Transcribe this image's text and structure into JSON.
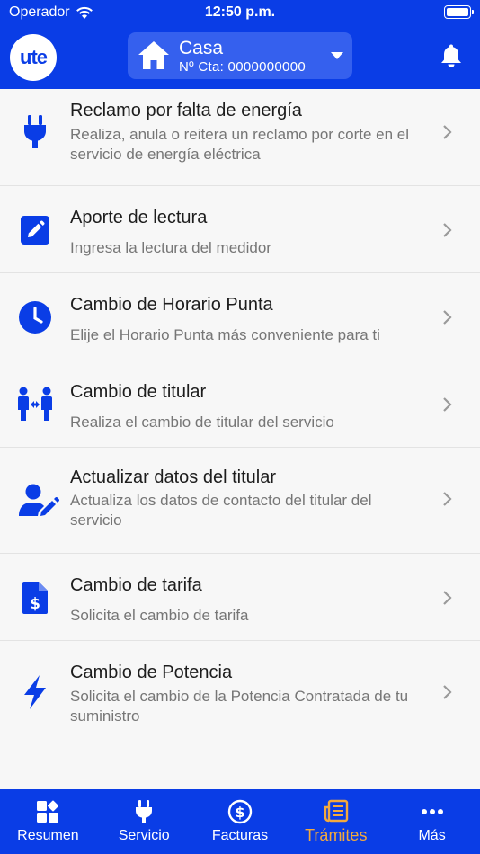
{
  "status_bar": {
    "carrier": "Operador",
    "time": "12:50 p.m."
  },
  "header": {
    "logo_text": "ute",
    "account_name": "Casa",
    "account_number": "Nº Cta: 0000000000"
  },
  "items": [
    {
      "icon": "plug-icon",
      "title": "Reclamo por falta de energía",
      "desc": "Realiza, anula o reitera un reclamo por corte en el servicio de energía eléctrica"
    },
    {
      "icon": "edit-icon",
      "title": "Aporte de lectura",
      "desc": "Ingresa la lectura del medidor"
    },
    {
      "icon": "clock-icon",
      "title": "Cambio de Horario Punta",
      "desc": "Elije el Horario Punta más conveniente para ti"
    },
    {
      "icon": "people-swap-icon",
      "title": "Cambio de titular",
      "desc": "Realiza el cambio de titular del servicio"
    },
    {
      "icon": "user-edit-icon",
      "title": "Actualizar datos del titular",
      "desc": "Actualiza los datos de contacto del titular del servicio"
    },
    {
      "icon": "invoice-dollar-icon",
      "title": "Cambio de tarifa",
      "desc": "Solicita el cambio de tarifa"
    },
    {
      "icon": "lightning-icon",
      "title": "Cambio de Potencia",
      "desc": "Solicita el cambio de la Potencia Contratada de tu suministro"
    }
  ],
  "tabs": [
    {
      "icon": "dashboard-icon",
      "label": "Resumen"
    },
    {
      "icon": "plug-icon",
      "label": "Servicio"
    },
    {
      "icon": "dollar-circle-icon",
      "label": "Facturas"
    },
    {
      "icon": "newspaper-icon",
      "label": "Trámites",
      "active": true
    },
    {
      "icon": "more-dots-icon",
      "label": "Más"
    }
  ],
  "colors": {
    "brand": "#0a3de6",
    "active_tab": "#f3a93d",
    "icon_blue": "#0a3de6"
  }
}
